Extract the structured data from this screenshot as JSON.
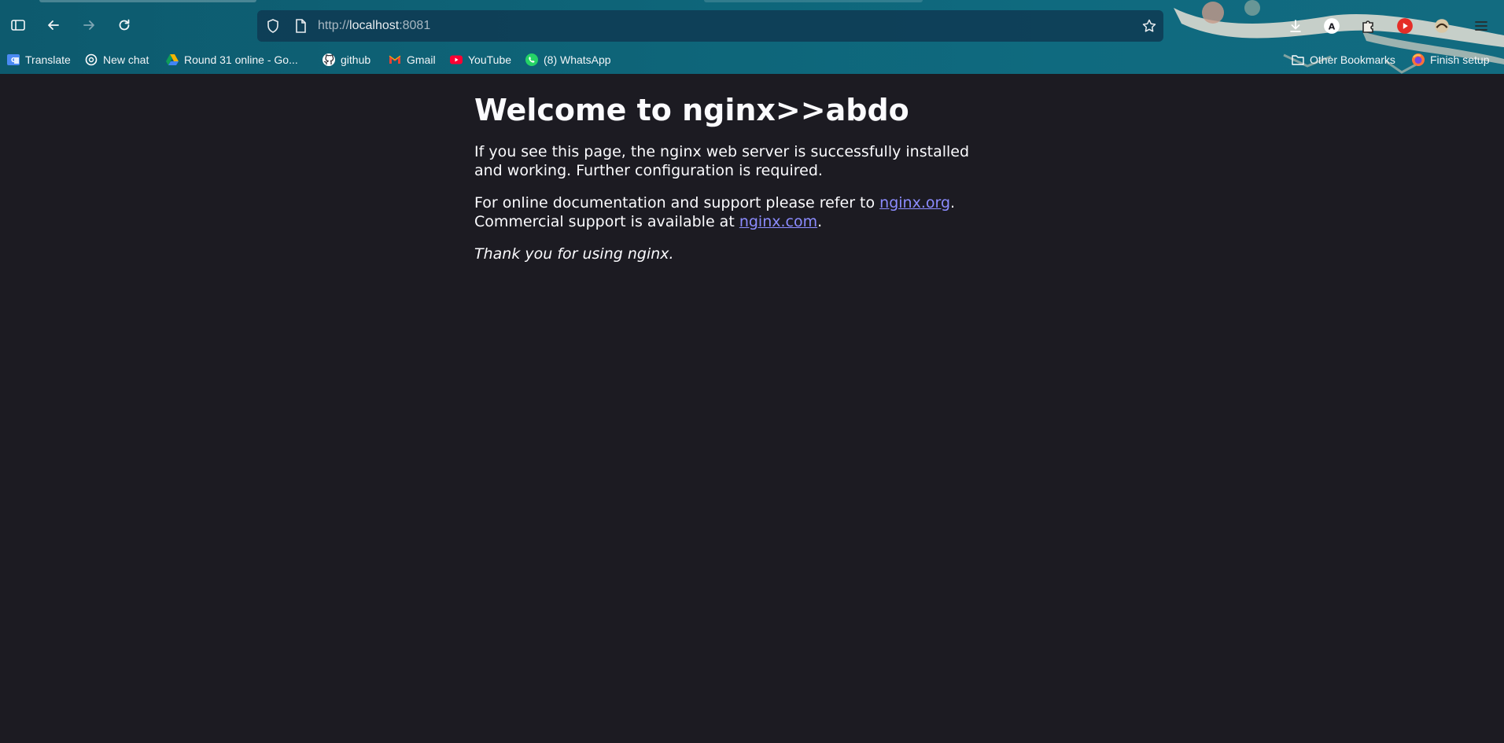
{
  "browser": {
    "url_scheme": "http://",
    "url_host": "localhost",
    "url_port": ":8081"
  },
  "bookmarks": [
    {
      "label": "Translate",
      "icon": "translate-icon",
      "color": "#4a8af4"
    },
    {
      "label": "New chat",
      "icon": "openai-icon",
      "color": "#ffffff"
    },
    {
      "label": "Round 31 online - Go...",
      "icon": "google-drive-icon",
      "color": "#f4b400"
    },
    {
      "label": "github",
      "icon": "github-icon",
      "color": "#ffffff"
    },
    {
      "label": "Gmail",
      "icon": "gmail-icon",
      "color": "#ea4335"
    },
    {
      "label": "YouTube",
      "icon": "youtube-icon",
      "color": "#ff0033"
    },
    {
      "label": "(8) WhatsApp",
      "icon": "whatsapp-icon",
      "color": "#25d366"
    }
  ],
  "bookmarks_right": [
    {
      "label": "Other Bookmarks",
      "icon": "folder-icon"
    },
    {
      "label": "Finish setup",
      "icon": "firefox-icon"
    }
  ],
  "page": {
    "heading": "Welcome to nginx>>abdo",
    "para1": "If you see this page, the nginx web server is successfully installed and working. Further configuration is required.",
    "para2_prefix": "For online documentation and support please refer to ",
    "link1": "nginx.org",
    "para2_mid": ".",
    "para2_line2": "Commercial support is available at ",
    "link2": "nginx.com",
    "para2_end": ".",
    "thanks": "Thank you for using nginx."
  },
  "colors": {
    "page_bg": "#1c1b22",
    "link": "#8c8cff",
    "chrome": "#0e6478"
  }
}
